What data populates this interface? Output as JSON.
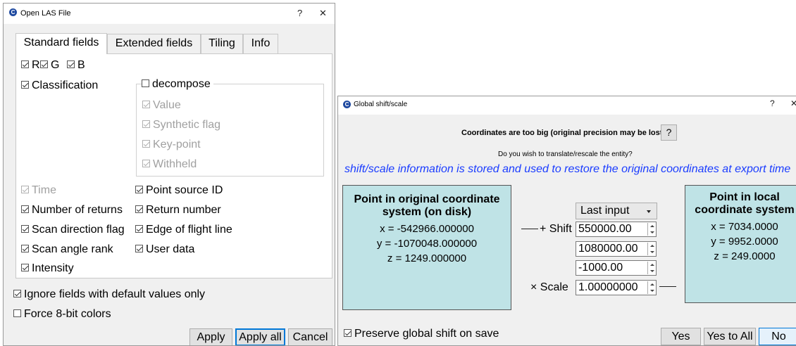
{
  "las_dialog": {
    "logo": "C",
    "title": "Open LAS File",
    "help": "?",
    "close": "✕",
    "tabs": [
      "Standard fields",
      "Extended fields",
      "Tiling",
      "Info"
    ],
    "rgb": [
      {
        "label": "R",
        "checked": true
      },
      {
        "label": "G",
        "checked": true
      },
      {
        "label": "B",
        "checked": true
      }
    ],
    "classification": {
      "label": "Classification",
      "checked": true
    },
    "decompose": {
      "label": "decompose",
      "checked": false,
      "items": [
        {
          "label": "Value",
          "checked": true,
          "disabled": true
        },
        {
          "label": "Synthetic flag",
          "checked": true,
          "disabled": true
        },
        {
          "label": "Key-point",
          "checked": true,
          "disabled": true
        },
        {
          "label": "Withheld",
          "checked": true,
          "disabled": true
        }
      ]
    },
    "fields_left": [
      {
        "label": "Time",
        "checked": true,
        "disabled": true
      },
      {
        "label": "Number of returns",
        "checked": true,
        "disabled": false
      },
      {
        "label": "Scan direction flag",
        "checked": true,
        "disabled": false
      },
      {
        "label": "Scan angle rank",
        "checked": true,
        "disabled": false
      },
      {
        "label": "Intensity",
        "checked": true,
        "disabled": false
      }
    ],
    "fields_right": [
      {
        "label": "Point source ID",
        "checked": true,
        "disabled": false
      },
      {
        "label": "Return number",
        "checked": true,
        "disabled": false
      },
      {
        "label": "Edge of flight line",
        "checked": true,
        "disabled": false
      },
      {
        "label": "User data",
        "checked": true,
        "disabled": false
      }
    ],
    "ignore_default": {
      "label": "Ignore fields with default values only",
      "checked": true
    },
    "force_8bit": {
      "label": "Force 8-bit colors",
      "checked": false
    },
    "buttons": {
      "apply": "Apply",
      "apply_all": "Apply all",
      "cancel": "Cancel"
    }
  },
  "shift_dialog": {
    "logo": "C",
    "title": "Global shift/scale",
    "help": "?",
    "close": "✕",
    "warning": "Coordinates are too big (original precision may be lost)!",
    "warning_help": "?",
    "question": "Do you wish to translate/rescale the entity?",
    "info": "shift/scale information is stored and used to restore the original coordinates at export time",
    "original_box": {
      "title": "Point in original coordinate system (on disk)",
      "x": "x = -542966.000000",
      "y": "y = -1070048.000000",
      "z": "z = 1249.000000"
    },
    "preset_combo": "Last input",
    "shift_label": "+ Shift",
    "shift_x": "550000.00",
    "shift_y": "1080000.00",
    "shift_z": "-1000.00",
    "scale_label": "× Scale",
    "scale": "1.00000000",
    "local_box": {
      "title": "Point in local coordinate system",
      "x": "x = 7034.0000",
      "y": "y = 9952.0000",
      "z": "z = 249.0000"
    },
    "preserve": {
      "label": "Preserve global shift on save",
      "checked": true
    },
    "buttons": {
      "yes": "Yes",
      "yes_all": "Yes to All",
      "no": "No"
    }
  }
}
